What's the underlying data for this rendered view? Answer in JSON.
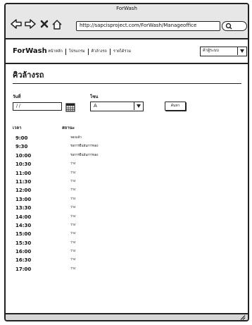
{
  "window": {
    "title": "ForWash"
  },
  "browser": {
    "url": "http://sapcisproject.com/ForWash/Manageoffice",
    "icons": [
      "back-arrow-icon",
      "forward-arrow-icon",
      "close-x-icon",
      "home-icon",
      "search-icon"
    ]
  },
  "navbar": {
    "brand": "ForWash",
    "menu": [
      "หน้าหลัก",
      "โปรแกรม",
      "คิวล้างรถ",
      "รายได้รวม"
    ],
    "branch_select": "ค้าผู้ระบบ"
  },
  "page": {
    "title": "คิวล้างรถ"
  },
  "form": {
    "date_label": "วันที่",
    "date_value": "/ /",
    "zone_label": "โซน",
    "zone_value": "A",
    "search_button": "ค้นหา"
  },
  "table": {
    "headers": {
      "time": "เวลา",
      "status": "สถานะ"
    },
    "rows": [
      {
        "time": "9:00",
        "status": "จองแล้ว"
      },
      {
        "time": "9:30",
        "status": "รอการยืนยันการจอง"
      },
      {
        "time": "10:00",
        "status": "รอการยืนยันการจอง"
      },
      {
        "time": "10:30",
        "status": "ว่าง"
      },
      {
        "time": "11:00",
        "status": "ว่าง"
      },
      {
        "time": "11:30",
        "status": "ว่าง"
      },
      {
        "time": "12:00",
        "status": "ว่าง"
      },
      {
        "time": "13:00",
        "status": "ว่าง"
      },
      {
        "time": "13:30",
        "status": "ว่าง"
      },
      {
        "time": "14:00",
        "status": "ว่าง"
      },
      {
        "time": "14:30",
        "status": "ว่าง"
      },
      {
        "time": "15:00",
        "status": "ว่าง"
      },
      {
        "time": "15:30",
        "status": "ว่าง"
      },
      {
        "time": "16:00",
        "status": "ว่าง"
      },
      {
        "time": "16:30",
        "status": "ว่าง"
      },
      {
        "time": "17:00",
        "status": "ว่าง"
      }
    ]
  }
}
